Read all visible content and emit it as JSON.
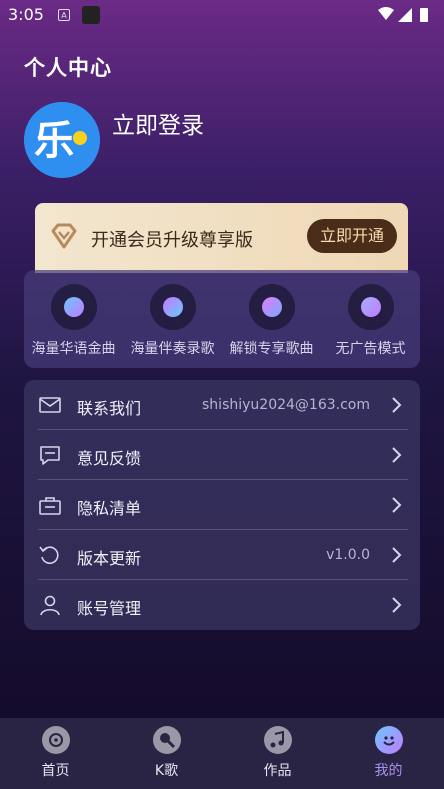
{
  "status_bar": {
    "time": "3:05",
    "notif_badge": "A"
  },
  "header": {
    "title": "个人中心"
  },
  "profile": {
    "avatar_char": "乐",
    "login_label": "立即登录"
  },
  "vip": {
    "text": "开通会员升级尊享版",
    "button_label": "立即开通"
  },
  "features": [
    {
      "label": "海量华语金曲",
      "icon": "music-disc-icon"
    },
    {
      "label": "海量伴奏录歌",
      "icon": "microphone-icon"
    },
    {
      "label": "解锁专享歌曲",
      "icon": "music-note-icon"
    },
    {
      "label": "无广告模式",
      "icon": "no-ads-icon"
    }
  ],
  "menu": [
    {
      "label": "联系我们",
      "value": "shishiyu2024@163.com",
      "icon": "mail-icon"
    },
    {
      "label": "意见反馈",
      "value": "",
      "icon": "feedback-icon"
    },
    {
      "label": "隐私清单",
      "value": "",
      "icon": "privacy-list-icon"
    },
    {
      "label": "版本更新",
      "value": "v1.0.0",
      "icon": "update-icon"
    },
    {
      "label": "账号管理",
      "value": "",
      "icon": "account-icon"
    }
  ],
  "tabs": [
    {
      "label": "首页",
      "icon": "home-disc-icon",
      "active": false
    },
    {
      "label": "K歌",
      "icon": "microphone-icon",
      "active": false
    },
    {
      "label": "作品",
      "icon": "music-note-icon",
      "active": false
    },
    {
      "label": "我的",
      "icon": "smiley-icon",
      "active": true
    }
  ],
  "colors": {
    "accent": "#a98ff0",
    "vip_button": "#4a2c18",
    "avatar_bg": "#2f8ff0"
  }
}
